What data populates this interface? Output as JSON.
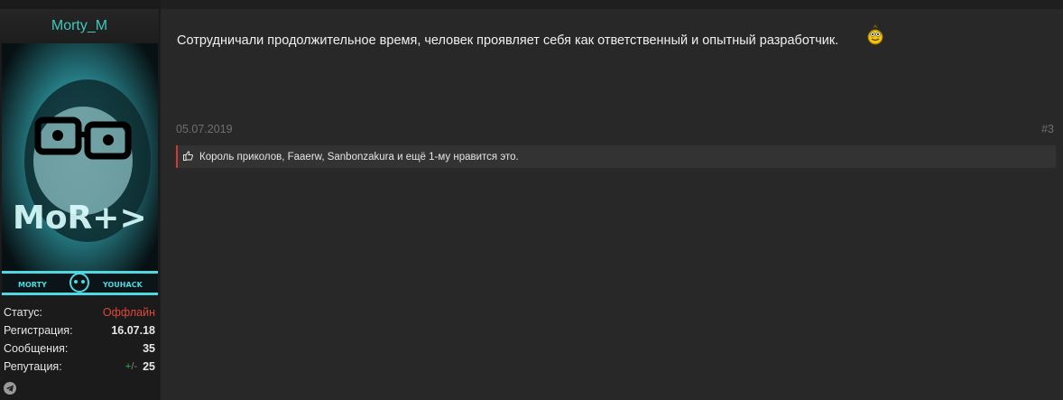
{
  "user": {
    "name": "Morty_M",
    "banner_left": "MORTY",
    "banner_right": "YOUHACK",
    "stats": [
      {
        "label": "Статус:",
        "value": "Оффлайн",
        "kind": "offline"
      },
      {
        "label": "Регистрация:",
        "value": "16.07.18",
        "kind": "normal"
      },
      {
        "label": "Сообщения:",
        "value": "35",
        "kind": "normal"
      }
    ],
    "reputation": {
      "label": "Репутация:",
      "plus": "+",
      "slash": "/-",
      "value": "25"
    }
  },
  "post": {
    "message": "Сотрудничали продолжительное время, человек проявляет себя как ответственный и опытный разработчик.",
    "date": "05.07.2019",
    "number": "#3",
    "likes_text": "Король приколов, Faaerw, Sanbonzakura и ещё 1-му нравится это."
  },
  "colors": {
    "username": "#3fc7c1",
    "offline": "#e0473a",
    "likes_accent": "#d13a2c",
    "rep_plus": "#3fae3f"
  },
  "icons": [
    "avatar-image",
    "smiley-icon",
    "thumbs-up-icon",
    "telegram-icon"
  ]
}
